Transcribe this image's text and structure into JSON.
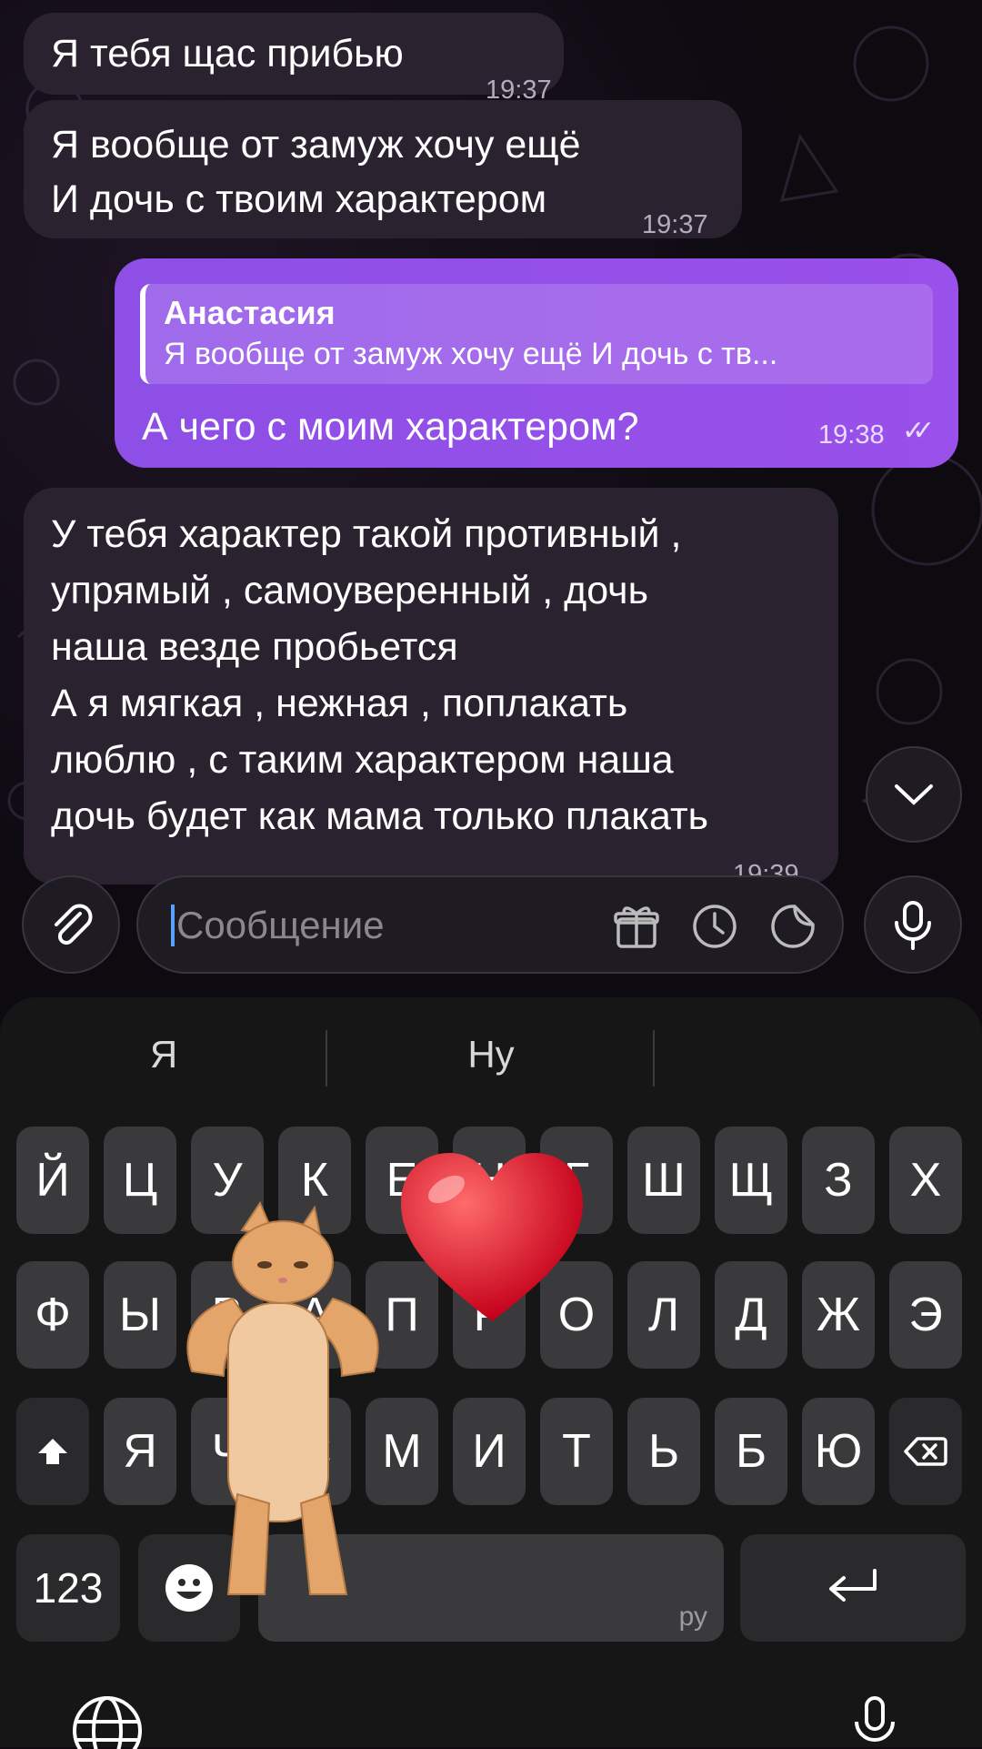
{
  "messages": [
    {
      "id": "m1",
      "text": "Я тебя щас прибью",
      "time": "19:37"
    },
    {
      "id": "m2",
      "lines": [
        "Я вообще от замуж хочу ещё",
        "И дочь с твоим характером"
      ],
      "time": "19:37"
    },
    {
      "id": "m3",
      "reply_name": "Анастасия",
      "reply_text": "Я вообще от замуж хочу ещё И дочь с тв...",
      "text": "А чего с моим характером?",
      "time": "19:38",
      "status": "✓✓"
    },
    {
      "id": "m4",
      "lines": [
        "У тебя характер такой противный ,",
        "упрямый , самоуверенный , дочь",
        "наша везде пробьется",
        "А я мягкая , нежная , поплакать",
        "люблю , с таким характером наша",
        "дочь будет как мама только плакать"
      ],
      "time": "19:39"
    }
  ],
  "input": {
    "placeholder": "Сообщение"
  },
  "suggestions": [
    "Я",
    "Ну",
    ""
  ],
  "keyboard": {
    "row1": [
      "Й",
      "Ц",
      "У",
      "К",
      "Е",
      "Н",
      "Г",
      "Ш",
      "Щ",
      "З",
      "Х"
    ],
    "row2": [
      "Ф",
      "Ы",
      "В",
      "А",
      "П",
      "Р",
      "О",
      "Л",
      "Д",
      "Ж",
      "Э"
    ],
    "row3": [
      "Я",
      "Ч",
      "С",
      "М",
      "И",
      "Т",
      "Ь",
      "Б",
      "Ю"
    ],
    "numbers_label": "123",
    "space_label": "ру"
  },
  "colors": {
    "outgoing": "#8d4fe6",
    "incoming": "#2b2230",
    "keyboard": "#161616"
  },
  "stickers": [
    "heart-emoji",
    "dancing-cat-sticker"
  ]
}
